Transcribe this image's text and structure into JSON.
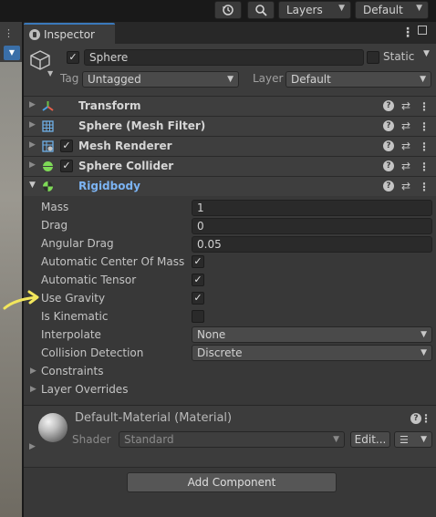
{
  "toolbar": {
    "layers_label": "Layers",
    "layout_label": "Default"
  },
  "inspector": {
    "tab_title": "Inspector",
    "object": {
      "active": true,
      "name": "Sphere",
      "static_label": "Static",
      "static_checked": false,
      "tag_label": "Tag",
      "tag_value": "Untagged",
      "layer_label": "Layer",
      "layer_value": "Default"
    },
    "components": [
      {
        "name": "Transform",
        "has_checkbox": false,
        "enabled": true,
        "icon": "transform-icon"
      },
      {
        "name": "Sphere (Mesh Filter)",
        "has_checkbox": false,
        "enabled": true,
        "icon": "mesh-filter-icon"
      },
      {
        "name": "Mesh Renderer",
        "has_checkbox": true,
        "enabled": true,
        "icon": "mesh-renderer-icon"
      },
      {
        "name": "Sphere Collider",
        "has_checkbox": true,
        "enabled": true,
        "icon": "sphere-collider-icon"
      },
      {
        "name": "Rigidbody",
        "has_checkbox": false,
        "enabled": true,
        "icon": "rigidbody-icon",
        "expanded": true
      }
    ],
    "rigidbody": {
      "mass_label": "Mass",
      "mass_value": "1",
      "drag_label": "Drag",
      "drag_value": "0",
      "angular_drag_label": "Angular Drag",
      "angular_drag_value": "0.05",
      "auto_com_label": "Automatic Center Of Mass",
      "auto_com_checked": true,
      "auto_tensor_label": "Automatic Tensor",
      "auto_tensor_checked": true,
      "use_gravity_label": "Use Gravity",
      "use_gravity_checked": true,
      "is_kinematic_label": "Is Kinematic",
      "is_kinematic_checked": false,
      "interpolate_label": "Interpolate",
      "interpolate_value": "None",
      "collision_label": "Collision Detection",
      "collision_value": "Discrete",
      "constraints_label": "Constraints",
      "layer_overrides_label": "Layer Overrides"
    },
    "material": {
      "title": "Default-Material (Material)",
      "shader_label": "Shader",
      "shader_value": "Standard",
      "edit_label": "Edit..."
    },
    "add_component_label": "Add Component"
  },
  "annotation": {
    "arrow_color": "#f2e65c"
  }
}
